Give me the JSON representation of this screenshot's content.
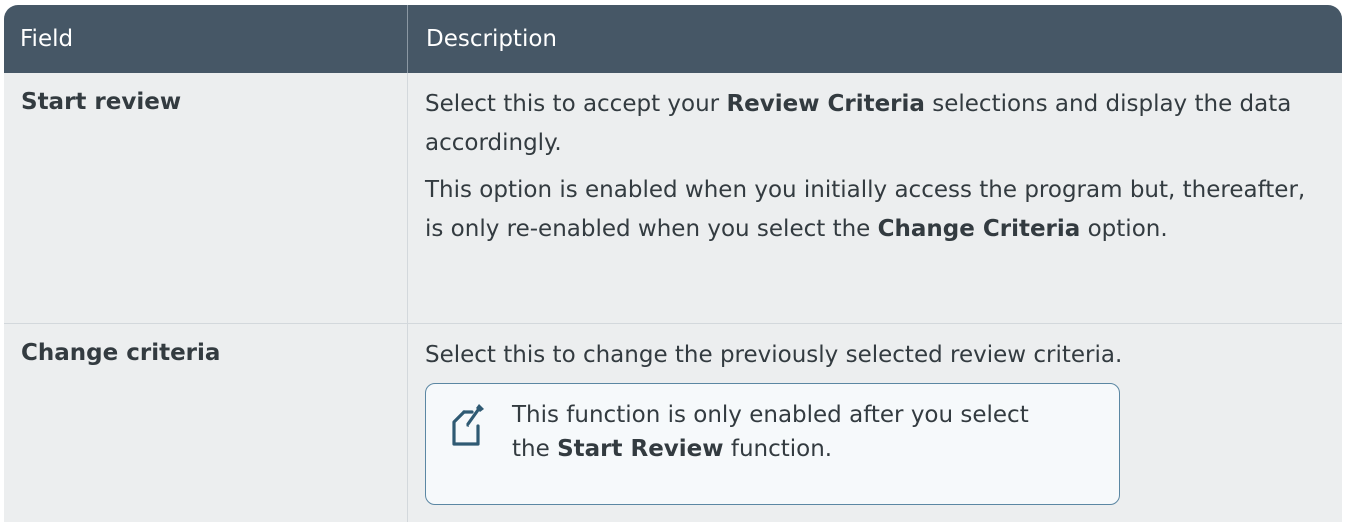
{
  "table": {
    "headers": {
      "field": "Field",
      "description": "Description"
    },
    "rows": [
      {
        "field": "Start review",
        "p1_pre": "Select this to accept your ",
        "p1_bold": "Review Criteria",
        "p1_post": " selections and display the data accordingly.",
        "p2_pre": "This option is enabled when you initially access the program but, thereafter, is only re-enabled when you select the ",
        "p2_bold": "Change Criteria",
        "p2_post": " option."
      },
      {
        "field": "Change criteria",
        "p1": "Select this to change the previously selected review criteria.",
        "note": {
          "icon": "note-edit-icon",
          "line1": "This function is only enabled after you select",
          "line2_pre": "the ",
          "line2_bold": "Start Review",
          "line2_post": " function."
        }
      }
    ]
  },
  "colors": {
    "header_bg": "#465766",
    "row_bg": "#eceeef",
    "note_border": "#5b87a3"
  }
}
